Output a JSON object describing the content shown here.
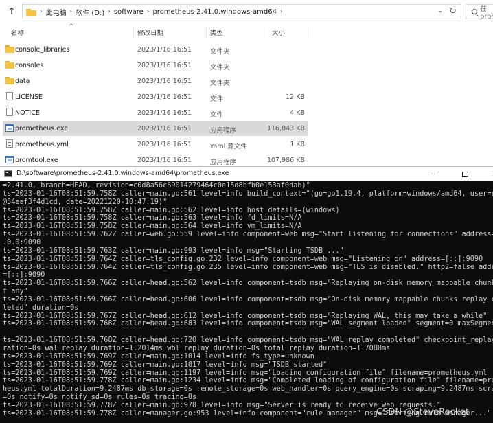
{
  "explorer": {
    "breadcrumb": [
      "此电脑",
      "软件 (D:)",
      "software",
      "prometheus-2.41.0.windows-amd64"
    ],
    "search_placeholder": "在 pror",
    "columns": {
      "name": "名称",
      "date": "修改日期",
      "type": "类型",
      "size": "大小"
    },
    "files": [
      {
        "icon": "folder-icon",
        "name": "console_libraries",
        "date": "2023/1/16 16:51",
        "type": "文件夹",
        "size": ""
      },
      {
        "icon": "folder-icon",
        "name": "consoles",
        "date": "2023/1/16 16:51",
        "type": "文件夹",
        "size": ""
      },
      {
        "icon": "folder-icon",
        "name": "data",
        "date": "2023/1/16 16:51",
        "type": "文件夹",
        "size": ""
      },
      {
        "icon": "file-icon",
        "name": "LICENSE",
        "date": "2023/1/16 16:51",
        "type": "文件",
        "size": "12 KB"
      },
      {
        "icon": "file-icon",
        "name": "NOTICE",
        "date": "2023/1/16 16:51",
        "type": "文件",
        "size": "4 KB"
      },
      {
        "icon": "exe-icon",
        "name": "prometheus.exe",
        "date": "2023/1/16 16:51",
        "type": "应用程序",
        "size": "116,043 KB",
        "selected": true
      },
      {
        "icon": "yml-file-icon",
        "name": "prometheus.yml",
        "date": "2023/1/16 16:51",
        "type": "Yaml 源文件",
        "size": "1 KB"
      },
      {
        "icon": "exe-icon",
        "name": "promtool.exe",
        "date": "2023/1/16 16:51",
        "type": "应用程序",
        "size": "107,986 KB"
      }
    ]
  },
  "console": {
    "title": "D:\\software\\prometheus-2.41.0.windows-amd64\\prometheus.exe",
    "lines": [
      "=2.41.0, branch=HEAD, revision=c0d8a56c69014279464c0e15d8bfb0e153af0dab)\"",
      "ts=2023-01-16T08:51:59.758Z caller=main.go:561 level=info build_context=\"(go=go1.19.4, platform=windows/amd64, user=root",
      "@54eaf3f4d1cd, date=20221220-10:47:19)\"",
      "ts=2023-01-16T08:51:59.758Z caller=main.go:562 level=info host_details=(windows)",
      "ts=2023-01-16T08:51:59.758Z caller=main.go:563 level=info fd_limits=N/A",
      "ts=2023-01-16T08:51:59.758Z caller=main.go:564 level=info vm_limits=N/A",
      "ts=2023-01-16T08:51:59.762Z caller=web.go:559 level=info component=web msg=\"Start listening for connections\" address=0.0",
      ".0.0:9090",
      "ts=2023-01-16T08:51:59.763Z caller=main.go:993 level=info msg=\"Starting TSDB ...\"",
      "ts=2023-01-16T08:51:59.764Z caller=tls_config.go:232 level=info component=web msg=\"Listening on\" address=[::]:9090",
      "ts=2023-01-16T08:51:59.764Z caller=tls_config.go:235 level=info component=web msg=\"TLS is disabled.\" http2=false address",
      "=[::]:9090",
      "ts=2023-01-16T08:51:59.766Z caller=head.go:562 level=info component=tsdb msg=\"Replaying on-disk memory mappable chunks i",
      "f any\"",
      "ts=2023-01-16T08:51:59.766Z caller=head.go:606 level=info component=tsdb msg=\"On-disk memory mappable chunks replay comp",
      "leted\" duration=0s",
      "ts=2023-01-16T08:51:59.767Z caller=head.go:612 level=info component=tsdb msg=\"Replaying WAL, this may take a while\"",
      "ts=2023-01-16T08:51:59.768Z caller=head.go:683 level=info component=tsdb msg=\"WAL segment loaded\" segment=0 maxSegment=0",
      "",
      "ts=2023-01-16T08:51:59.768Z caller=head.go:720 level=info component=tsdb msg=\"WAL replay completed\" checkpoint_replay_du",
      "ration=0s wal_replay_duration=1.2014ms wbl_replay_duration=0s total_replay_duration=1.7088ms",
      "ts=2023-01-16T08:51:59.769Z caller=main.go:1014 level=info fs_type=unknown",
      "ts=2023-01-16T08:51:59.769Z caller=main.go:1017 level=info msg=\"TSDB started\"",
      "ts=2023-01-16T08:51:59.769Z caller=main.go:1197 level=info msg=\"Loading configuration file\" filename=prometheus.yml",
      "ts=2023-01-16T08:51:59.778Z caller=main.go:1234 level=info msg=\"Completed loading of configuration file\" filename=promet",
      "heus.yml totalDuration=9.2487ms db_storage=0s remote_storage=0s web_handler=0s query_engine=0s scraping=9.2487ms scrape_sd",
      "=0s notify=0s notify_sd=0s rules=0s tracing=0s",
      "ts=2023-01-16T08:51:59.778Z caller=main.go:978 level=info msg=\"Server is ready to receive web requests.\"",
      "ts=2023-01-16T08:51:59.778Z caller=manager.go:953 level=info component=\"rule manager\" msg=\"Starting rule manager...\""
    ]
  },
  "watermark": "CSDN @SteveRocket"
}
